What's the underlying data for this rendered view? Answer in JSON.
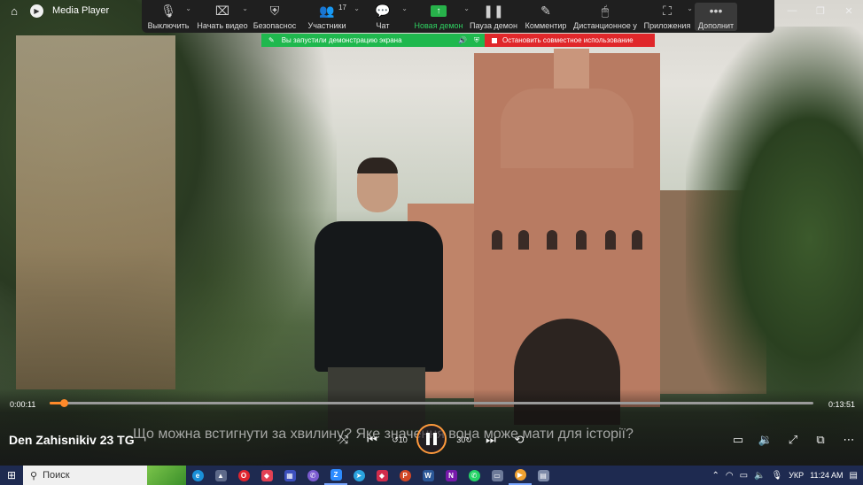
{
  "window": {
    "app_name": "Media Player"
  },
  "zoom_toolbar": {
    "mute": "Выключить",
    "video": "Начать видео",
    "security": "Безопаснос",
    "participants": "Участники",
    "participants_count": "17",
    "chat": "Чат",
    "new_share": "Новая демон",
    "pause_share": "Пауза демон",
    "annotate": "Комментир",
    "remote_control": "Дистанционное у",
    "apps": "Приложения",
    "more": "Дополнит"
  },
  "share_banner": {
    "status": "Вы запустили демонстрацию экрана",
    "stop": "Остановить совместное использование"
  },
  "player": {
    "elapsed": "0:00:11",
    "duration": "0:13:51",
    "progress": 0.019,
    "title": "Den Zahisnikiv 23 TG",
    "subtitle": "Що можна встигнути за хвилину? Яке значення вона може мати для історії?",
    "skip_back_label": "10",
    "skip_forward_label": "30"
  },
  "taskbar": {
    "search_placeholder": "Поиск",
    "language": "УКР",
    "time": "11:24 AM"
  },
  "colors": {
    "accent": "#ff8a2a",
    "zoom_green": "#1fb84e",
    "zoom_red": "#e0272a",
    "taskbar": "#1e2a50"
  }
}
